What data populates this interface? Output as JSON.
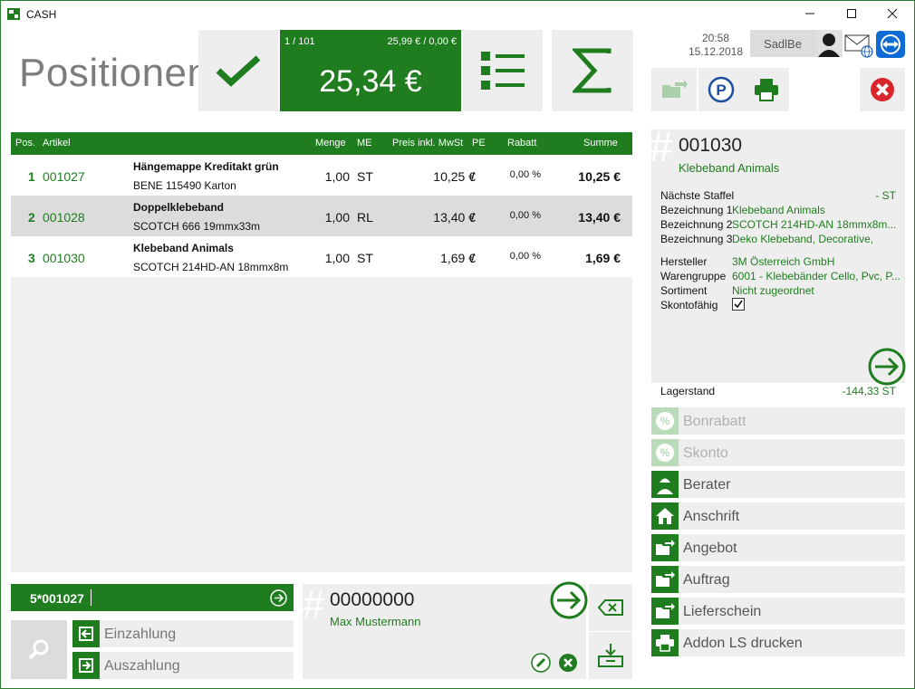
{
  "window": {
    "title": "CASH"
  },
  "header": {
    "title": "Positionen",
    "position_count": "1 / 101",
    "subtotal": "25,99 € / 0,00 €",
    "total": "25,34 €",
    "time": "20:58",
    "date": "15.12.2018",
    "user": "SadlBe"
  },
  "table": {
    "columns": [
      "Pos.",
      "Artikel",
      "Menge",
      "ME",
      "Preis inkl. MwSt",
      "PE",
      "Rabatt",
      "Summe"
    ],
    "rows": [
      {
        "pos": "1",
        "article": "001027",
        "name": "Hängemappe Kreditakt grün",
        "desc": "BENE 115490 Karton",
        "qty": "1,00",
        "unit": "ST",
        "price": "10,25 €",
        "pe": "/",
        "discount": "0,00 %",
        "sum": "10,25 €"
      },
      {
        "pos": "2",
        "article": "001028",
        "name": "Doppelklebeband",
        "desc": "SCOTCH 666 19mmx33m",
        "qty": "1,00",
        "unit": "RL",
        "price": "13,40 €",
        "pe": "/",
        "discount": "0,00 %",
        "sum": "13,40 €"
      },
      {
        "pos": "3",
        "article": "001030",
        "name": "Klebeband Animals",
        "desc": "SCOTCH 214HD-AN 18mmx8m",
        "qty": "1,00",
        "unit": "ST",
        "price": "1,69 €",
        "pe": "/",
        "discount": "0,00 %",
        "sum": "1,69 €"
      }
    ]
  },
  "input": {
    "value": "5*001027"
  },
  "payments": {
    "deposit": "Einzahlung",
    "withdrawal": "Auszahlung"
  },
  "customer": {
    "hash": "#",
    "number": "00000000",
    "name": "Max Mustermann"
  },
  "detail": {
    "hash": "#",
    "article": "001030",
    "name": "Klebeband Animals",
    "fields": [
      {
        "key": "Nächste Staffel",
        "value": "- ST"
      },
      {
        "key": "Bezeichnung 1",
        "value": "Klebeband Animals"
      },
      {
        "key": "Bezeichnung 2",
        "value": "SCOTCH 214HD-AN 18mmx8m..."
      },
      {
        "key": "Bezeichnung 3",
        "value": "Deko Klebeband, Decorative,"
      },
      {
        "key": "Hersteller",
        "value": "3M Österreich GmbH"
      },
      {
        "key": "Warengruppe",
        "value": "6001 - Klebebänder Cello, Pvc, P..."
      },
      {
        "key": "Sortiment",
        "value": "Nicht zugeordnet"
      },
      {
        "key": "Skontofähig",
        "value": ""
      }
    ],
    "skonto_checked": true,
    "stock_label": "Lagerstand",
    "stock_value": "-144,33 ST"
  },
  "actions": [
    {
      "label": "Bonrabatt",
      "enabled": false,
      "icon": "percent-icon"
    },
    {
      "label": "Skonto",
      "enabled": false,
      "icon": "percent-icon"
    },
    {
      "label": "Berater",
      "enabled": true,
      "icon": "person-icon"
    },
    {
      "label": "Anschrift",
      "enabled": true,
      "icon": "house-icon"
    },
    {
      "label": "Angebot",
      "enabled": true,
      "icon": "folder-arrow-icon"
    },
    {
      "label": "Auftrag",
      "enabled": true,
      "icon": "folder-arrow-icon"
    },
    {
      "label": "Lieferschein",
      "enabled": true,
      "icon": "folder-arrow-icon"
    },
    {
      "label": "Addon LS drucken",
      "enabled": true,
      "icon": "printer-icon"
    }
  ],
  "colors": {
    "accent": "#1f7d1f",
    "tile": "#eeeeee",
    "close_red": "#d9262b",
    "teamviewer_blue": "#0e6bd6"
  }
}
